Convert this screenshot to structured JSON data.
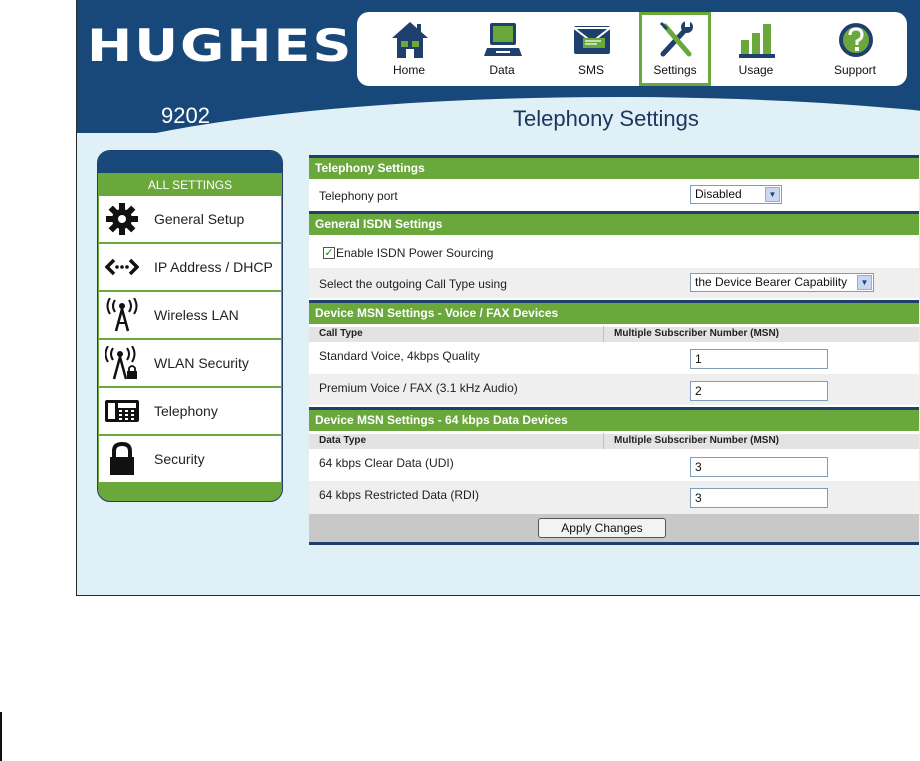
{
  "brand": {
    "logo_text": "HUGHES",
    "model": "9202"
  },
  "page_title": "Telephony Settings",
  "topnav": [
    {
      "label": "Home",
      "icon": "home-icon"
    },
    {
      "label": "Data",
      "icon": "data-icon"
    },
    {
      "label": "SMS",
      "icon": "sms-icon"
    },
    {
      "label": "Settings",
      "icon": "settings-icon",
      "active": true
    },
    {
      "label": "Usage",
      "icon": "usage-icon"
    },
    {
      "label": "Support",
      "icon": "support-icon"
    }
  ],
  "sidebar": {
    "header": "ALL SETTINGS",
    "items": [
      {
        "label": "General Setup",
        "icon": "gear-icon"
      },
      {
        "label": "IP Address / DHCP",
        "icon": "network-arrows-icon"
      },
      {
        "label": "Wireless LAN",
        "icon": "wireless-tower-icon"
      },
      {
        "label": "WLAN Security",
        "icon": "wireless-lock-icon"
      },
      {
        "label": "Telephony",
        "icon": "phone-icon"
      },
      {
        "label": "Security",
        "icon": "lock-icon"
      }
    ]
  },
  "telephony": {
    "section_title": "Telephony Settings",
    "port_label": "Telephony port",
    "port_value": "Disabled"
  },
  "isdn": {
    "section_title": "General ISDN Settings",
    "power_label": "Enable ISDN Power Sourcing",
    "power_checked": true,
    "calltype_label": "Select the outgoing Call Type using",
    "calltype_value": "the Device Bearer Capability"
  },
  "voice": {
    "section_title": "Device MSN Settings - Voice / FAX Devices",
    "col1": "Call Type",
    "col2": "Multiple Subscriber Number (MSN)",
    "rows": [
      {
        "label": "Standard Voice, 4kbps Quality",
        "value": "1"
      },
      {
        "label": "Premium Voice / FAX (3.1 kHz Audio)",
        "value": "2"
      }
    ]
  },
  "data_devices": {
    "section_title": "Device MSN Settings - 64 kbps Data Devices",
    "col1": "Data Type",
    "col2": "Multiple Subscriber Number (MSN)",
    "rows": [
      {
        "label": "64 kbps Clear Data (UDI)",
        "value": "3"
      },
      {
        "label": "64 kbps Restricted Data (RDI)",
        "value": "3"
      }
    ]
  },
  "apply_label": "Apply Changes",
  "colors": {
    "navy": "#18477a",
    "green": "#6ba83b",
    "light_blue": "#dff0f7"
  }
}
